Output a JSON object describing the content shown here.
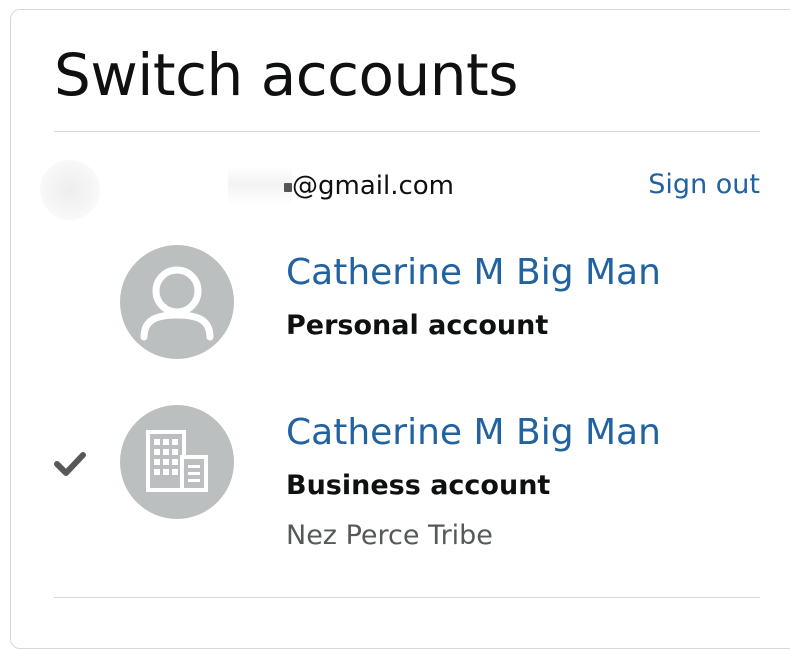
{
  "dialog": {
    "title": "Switch accounts"
  },
  "signed_in": {
    "email": "@gmail.com",
    "sign_out_label": "Sign out"
  },
  "accounts": [
    {
      "name": "Catherine M Big Man",
      "type": "Personal account",
      "icon": "person-icon",
      "selected": false
    },
    {
      "name": "Catherine M Big Man",
      "type": "Business account",
      "organization": "Nez Perce Tribe",
      "icon": "building-icon",
      "selected": true
    }
  ],
  "colors": {
    "link": "#2162a1",
    "text": "#0f1111",
    "muted": "#565959",
    "avatar_bg": "#bbbfbf",
    "divider": "#d5d9d9"
  }
}
